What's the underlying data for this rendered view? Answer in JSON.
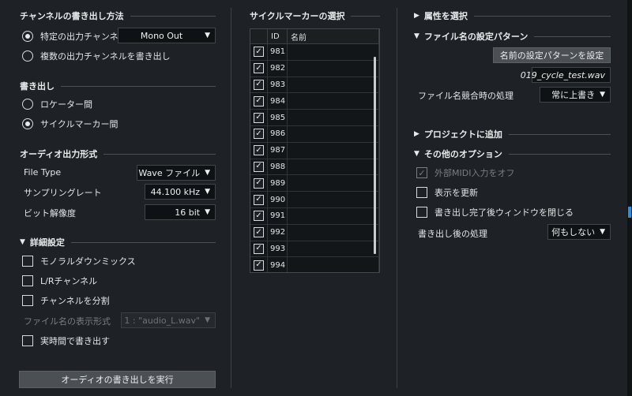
{
  "channel": {
    "title": "チャンネルの書き出し方法",
    "option_specific": "特定の出力チャンネル.",
    "option_specific_value": "Mono Out",
    "option_multi": "複数の出力チャンネルを書き出し"
  },
  "export": {
    "title": "書き出し",
    "option_locator": "ロケーター間",
    "option_cycle": "サイクルマーカー間"
  },
  "audio_format": {
    "title": "オーディオ出力形式",
    "file_type_label": "File Type",
    "file_type_value": "Wave ファイル",
    "sample_rate_label": "サンプリングレート",
    "sample_rate_value": "44.100 kHz",
    "bit_depth_label": "ビット解像度",
    "bit_depth_value": "16 bit"
  },
  "advanced": {
    "title": "詳細設定",
    "mono_downmix": "モノラルダウンミックス",
    "lr_channel": "L/Rチャンネル",
    "split_channel": "チャンネルを分割",
    "filename_display_label": "ファイル名の表示形式",
    "filename_display_value": "1 : \"audio_L.wav\"",
    "realtime": "実時間で書き出す"
  },
  "run_button": "オーディオの書き出しを実行",
  "markers": {
    "title": "サイクルマーカーの選択",
    "col_id": "ID",
    "col_name": "名前",
    "rows": [
      "981",
      "982",
      "983",
      "984",
      "985",
      "986",
      "987",
      "988",
      "989",
      "990",
      "991",
      "992",
      "993",
      "994"
    ]
  },
  "right": {
    "attr_title": "属性を選択",
    "pattern_title": "ファイル名の設定パターン",
    "pattern_button": "名前の設定パターンを設定",
    "filename_value": "019_cycle_test.wav",
    "conflict_label": "ファイル名競合時の処理",
    "conflict_value": "常に上書き",
    "project_title": "プロジェクトに追加",
    "other_title": "その他のオプション",
    "midi_off": "外部MIDI入力をオフ",
    "refresh_display": "表示を更新",
    "close_window": "書き出し完了後ウィンドウを閉じる",
    "post_process_label": "書き出し後の処理",
    "post_process_value": "何もしない"
  },
  "glyphs": {
    "check": "✓",
    "arrow_down": "▼",
    "arrow_right": "▶"
  },
  "colors": {
    "background": "#1e2226",
    "field": "#0f1214",
    "button": "#4b5055"
  }
}
